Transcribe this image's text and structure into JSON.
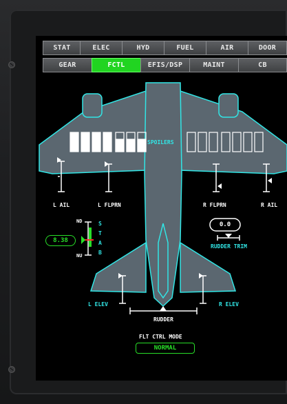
{
  "tabs_row1": [
    "STAT",
    "ELEC",
    "HYD",
    "FUEL",
    "AIR",
    "DOOR"
  ],
  "tabs_row2": [
    "GEAR",
    "FCTL",
    "EFIS/DSP",
    "MAINT",
    "CB"
  ],
  "active_tab": "FCTL",
  "spoilers_label": "SPOILERS",
  "labels": {
    "l_ail": "L AIL",
    "l_flprn": "L FLPRN",
    "r_flprn": "R FLPRN",
    "r_ail": "R AIL",
    "l_elev": "L ELEV",
    "r_elev": "R ELEV",
    "rudder": "RUDDER",
    "rudder_trim": "RUDDER TRIM"
  },
  "stab": {
    "value": "8.38",
    "nose_down": "ND",
    "nose_up": "NU",
    "letters": [
      "S",
      "T",
      "A",
      "B"
    ]
  },
  "rudder_trim_value": "0.0",
  "flt_ctrl_mode": {
    "label": "FLT CTRL MODE",
    "value": "NORMAL"
  },
  "colors": {
    "cyan": "#31e6e6",
    "green": "#28e028",
    "active_tab": "#21d421",
    "fuselage_fill": "#5b6770"
  },
  "icons": [
    "screw-icon",
    "stab-pointer-icon",
    "surface-pointer-icon"
  ]
}
